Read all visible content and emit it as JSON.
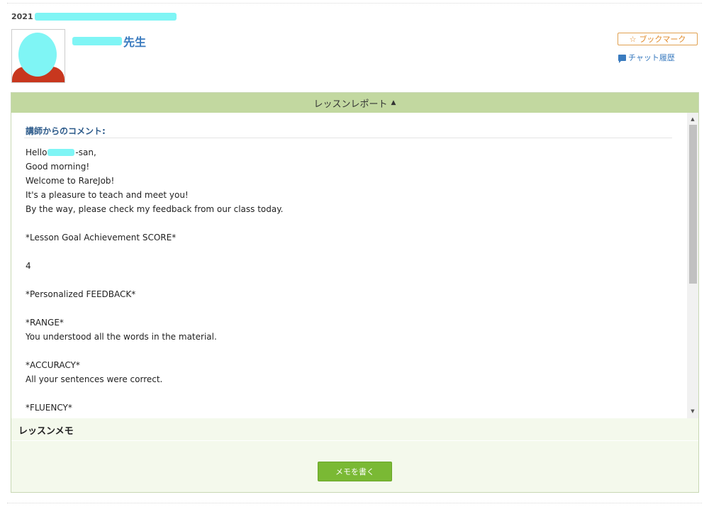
{
  "header": {
    "date_prefix": "2021",
    "teacher_suffix": "先生"
  },
  "actions": {
    "bookmark_label": "ブックマーク",
    "bookmark_icon": "star-outline-icon",
    "chat_history_label": "チャット履歴",
    "chat_icon": "chat-bubble-icon"
  },
  "report": {
    "header_label": "レッスンレポート",
    "comment_title": "講師からのコメント:",
    "greeting_prefix": "Hello",
    "greeting_suffix": "-san,",
    "lines": [
      "Good morning!",
      "Welcome to RareJob!",
      "It's a pleasure to teach and meet you!",
      "By the way, please check my feedback from our class today.",
      "",
      "*Lesson Goal Achievement SCORE*",
      "",
      "4",
      "",
      "*Personalized FEEDBACK*",
      "",
      "*RANGE*",
      "You understood all the words in the material.",
      "",
      "*ACCURACY*",
      "All your sentences were correct.",
      "",
      "*FLUENCY*"
    ]
  },
  "memo": {
    "title": "レッスンメモ",
    "write_button_label": "メモを書く"
  },
  "colors": {
    "accent_blue": "#3a7bbf",
    "header_green": "#c2d8a0",
    "button_green": "#7ab934",
    "bookmark_orange": "#e08a2a",
    "redaction_cyan": "#7ff5f5"
  }
}
